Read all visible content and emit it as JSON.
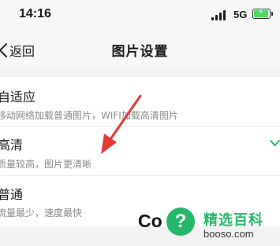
{
  "status_bar": {
    "time": "14:16",
    "network": "5G"
  },
  "nav": {
    "back_label": "返回",
    "title": "图片设置"
  },
  "options": [
    {
      "title": "自适应",
      "desc": "移动网络加载普通图片，WIFI加载高清图片",
      "selected": false
    },
    {
      "title": "高清",
      "desc": "质量较高，图片更清晰",
      "selected": true
    },
    {
      "title": "普通",
      "desc": "流量最少，速度最快",
      "selected": false
    }
  ],
  "annotation": {
    "arrow_color": "#e53935"
  },
  "watermark": {
    "partial_text": "Co",
    "logo_glyph": "?",
    "site_name": "精选百科",
    "domain": "booso.com",
    "brand_color": "#25b86a"
  },
  "colors": {
    "accent_check": "#25b86a",
    "battery": "#4cd964"
  }
}
